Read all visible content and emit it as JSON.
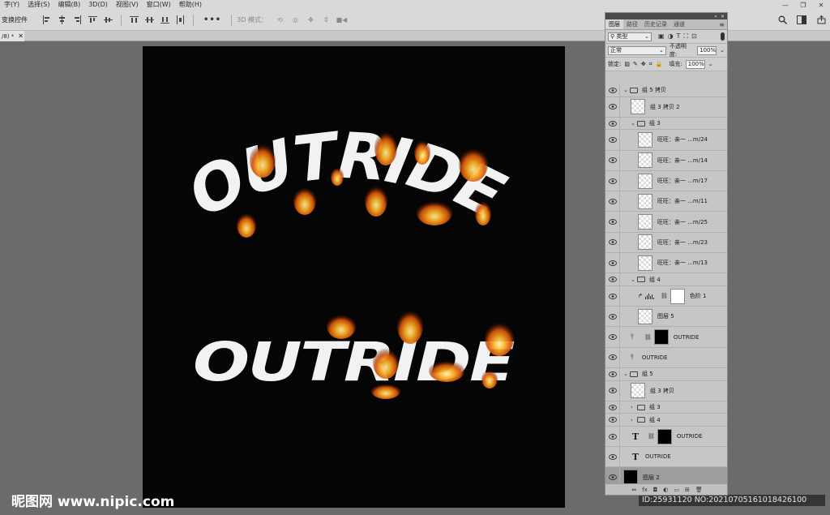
{
  "menubar": {
    "items": [
      "字(Y)",
      "选择(S)",
      "编辑(B)",
      "3D(D)",
      "视图(V)",
      "窗口(W)",
      "帮助(H)"
    ]
  },
  "options": {
    "label": "变换控件",
    "mode_3d": "3D 模式："
  },
  "doc_tab": {
    "label": "/8) *"
  },
  "canvas": {
    "text_top": "OUTRIDE",
    "text_bottom": "OUTRIDE"
  },
  "watermark": {
    "site": "昵图网 www.nipic.com",
    "id": "ID:25931120 NO:20210705161018426100"
  },
  "layers_panel": {
    "tabs": [
      {
        "label": "图层",
        "active": true
      },
      {
        "label": "路径",
        "active": false
      },
      {
        "label": "历史记录",
        "active": false
      },
      {
        "label": "通道",
        "active": false
      }
    ],
    "filter": "类型",
    "blend_mode": "正常",
    "opacity_label": "不透明度:",
    "opacity": "100%",
    "lock_label": "锁定:",
    "fill_label": "填充:",
    "fill": "100%",
    "layers": [
      {
        "kind": "group",
        "name": "组 5 拷贝",
        "indent": 0,
        "open": true
      },
      {
        "kind": "layer",
        "name": "组 3 拷贝 2",
        "indent": 1,
        "thumb": "trans"
      },
      {
        "kind": "group",
        "name": "组 3",
        "indent": 1,
        "open": true
      },
      {
        "kind": "layer",
        "name": "旺旺：亲一 ...m/24",
        "indent": 2,
        "thumb": "trans"
      },
      {
        "kind": "layer",
        "name": "旺旺：亲一 ...m/14",
        "indent": 2,
        "thumb": "trans"
      },
      {
        "kind": "layer",
        "name": "旺旺：亲一 ...m/17",
        "indent": 2,
        "thumb": "trans"
      },
      {
        "kind": "layer",
        "name": "旺旺：亲一 ...m/11",
        "indent": 2,
        "thumb": "trans"
      },
      {
        "kind": "layer",
        "name": "旺旺：亲一 ...m/25",
        "indent": 2,
        "thumb": "trans"
      },
      {
        "kind": "layer",
        "name": "旺旺：亲一 ...m/23",
        "indent": 2,
        "thumb": "trans"
      },
      {
        "kind": "layer",
        "name": "旺旺：亲一 ...m/13",
        "indent": 2,
        "thumb": "trans"
      },
      {
        "kind": "group",
        "name": "组 4",
        "indent": 1,
        "open": true
      },
      {
        "kind": "adjust",
        "name": "色阶 1",
        "indent": 2
      },
      {
        "kind": "layer",
        "name": "图层 5",
        "indent": 2,
        "thumb": "trans"
      },
      {
        "kind": "warp",
        "name": "OUTRIDE",
        "indent": 1
      },
      {
        "kind": "warptext",
        "name": "OUTRIDE",
        "indent": 1
      },
      {
        "kind": "group",
        "name": "组 5",
        "indent": 0,
        "open": true
      },
      {
        "kind": "layer",
        "name": "组 3 拷贝",
        "indent": 1,
        "thumb": "trans"
      },
      {
        "kind": "group",
        "name": "组 3",
        "indent": 1,
        "open": false
      },
      {
        "kind": "group",
        "name": "组 4",
        "indent": 1,
        "open": false
      },
      {
        "kind": "text",
        "name": "OUTRIDE",
        "indent": 1,
        "masked": true
      },
      {
        "kind": "text",
        "name": "OUTRIDE",
        "indent": 1,
        "masked": false
      },
      {
        "kind": "layer",
        "name": "图层 2",
        "indent": 0,
        "thumb": "black",
        "selected": true
      }
    ],
    "footer_icons": [
      "link-icon",
      "fx-icon",
      "mask-icon",
      "adjustment-icon",
      "folder-icon",
      "new-layer-icon",
      "trash-icon"
    ],
    "footer_labels": [
      "⇔",
      "fx",
      "◘",
      "◐",
      "▭",
      "⊞",
      "🗑"
    ]
  }
}
